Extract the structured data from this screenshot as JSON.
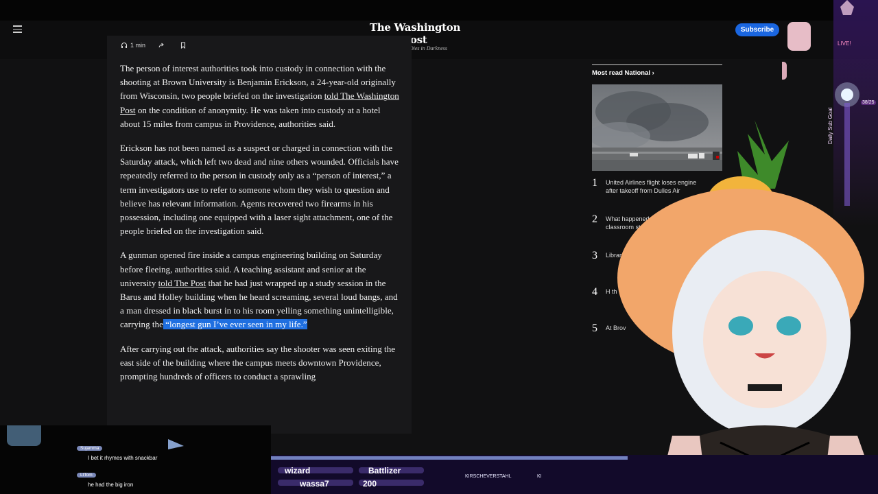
{
  "site": {
    "logo_name": "The Washington Post",
    "logo_tagline": "Democracy Dies in Darkness",
    "subscribe_label": "Subscribe"
  },
  "article": {
    "read_time": "1 min",
    "paragraphs": {
      "p1": {
        "a": "The person of interest authorities took into custody in connection with the shooting at Brown University is Benjamin Erickson, a 24-year-old originally from Wisconsin, two people briefed on the investigation ",
        "link": "told The Washington Post",
        "b": " on the condition of anonymity. He was taken into custody at a hotel about 15 miles from campus in Providence, authorities said."
      },
      "p2": "Erickson has not been named as a suspect or charged in connection with the Saturday attack, which left two dead and nine others wounded. Officials have repeatedly referred to the person in custody only as a “person of interest,” a term investigators use to refer to someone whom they wish to question and believe has relevant information. Agents recovered two firearms in his possession, including one equipped with a laser sight attachment, one of the people briefed on the investigation said.",
      "p3": {
        "a": "A gunman opened fire inside a campus engineering building on Saturday before fleeing, authorities said. A teaching assistant and senior at the university ",
        "link": "told The Post",
        "b": " that he had just wrapped up a study session in the Barus and Holley building when he heard screaming, several loud bangs, and a man dressed in black burst in to his room yelling something unintelligible, carrying the",
        "highlight": " “longest gun I’ve ever seen in my life.”"
      },
      "p4": "After carrying out the attack, authorities say the shooter was seen exiting the east side of the building where the campus meets downtown Providence, prompting hundreds of officers to conduct a sprawling"
    }
  },
  "most_read": {
    "heading": "Most read National",
    "items": [
      {
        "num": "1",
        "text": "United Airlines flight loses engine after takeoff from Dulles Air"
      },
      {
        "num": "2",
        "text": "What happened insid University classroom stormed"
      },
      {
        "num": "3",
        "text": "Library keep c"
      },
      {
        "num": "4",
        "text": "H th"
      },
      {
        "num": "5",
        "text": "At Brov"
      }
    ]
  },
  "stream": {
    "goal_label": "Daily Sub Goal",
    "goal_count": "38/25",
    "live_label": "LIVE!",
    "chat": [
      {
        "user": "Sujamma",
        "message": "I bet it rhymes with snackbar"
      },
      {
        "user": "LtTom",
        "message": "he had the big iron"
      }
    ],
    "bar": {
      "item1": "wizard",
      "item2": "wassa7",
      "item3": "Battlizer",
      "item4": "200",
      "social1": "KIRSCHEVERSTAHL",
      "social2": "KI"
    }
  },
  "colors": {
    "accent_blue": "#1a66e0",
    "highlight": "#1f6fe0",
    "background": "#111112"
  }
}
